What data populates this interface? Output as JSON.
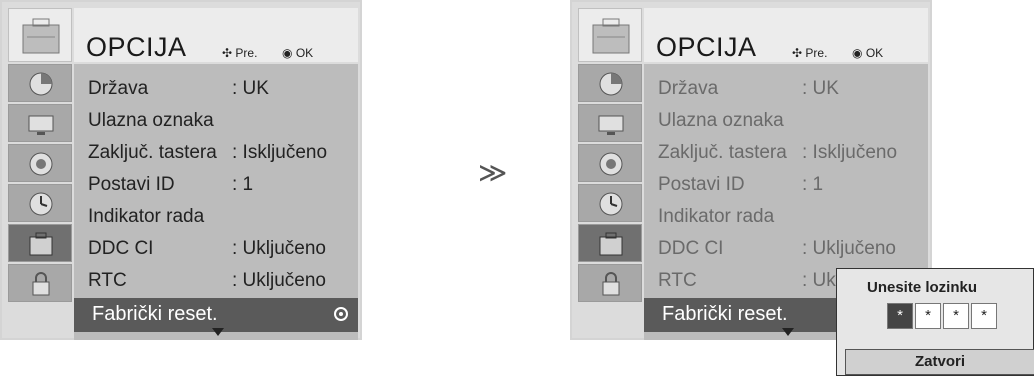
{
  "left_menu": {
    "title": "OPCIJA",
    "hint_move": "Pre.",
    "hint_ok": "OK",
    "rows": [
      {
        "label": "Država",
        "value": ": UK"
      },
      {
        "label": "Ulazna oznaka",
        "value": ""
      },
      {
        "label": "Zaključ. tastera",
        "value": ": Isključeno"
      },
      {
        "label": "Postavi ID",
        "value": ": 1"
      },
      {
        "label": "Indikator rada",
        "value": ""
      },
      {
        "label": "DDC CI",
        "value": ": Uključeno"
      },
      {
        "label": "RTC",
        "value": ": Uključeno"
      }
    ],
    "selected_item": "Fabrički reset."
  },
  "right_menu": {
    "title": "OPCIJA",
    "hint_move": "Pre.",
    "hint_ok": "OK",
    "rows": [
      {
        "label": "Država",
        "value": ": UK"
      },
      {
        "label": "Ulazna oznaka",
        "value": ""
      },
      {
        "label": "Zaključ. tastera",
        "value": ": Isključeno"
      },
      {
        "label": "Postavi ID",
        "value": ": 1"
      },
      {
        "label": "Indikator rada",
        "value": ""
      },
      {
        "label": "DDC CI",
        "value": ": Uključeno"
      },
      {
        "label": "RTC",
        "value": ": Uk"
      }
    ],
    "selected_item": "Fabrički reset."
  },
  "transition_arrow": "≫",
  "password_popup": {
    "title": "Unesite lozinku",
    "digits": [
      "*",
      "*",
      "*",
      "*"
    ],
    "close_label": "Zatvori"
  },
  "sidebar_icons": [
    "picture-icon",
    "screen-icon",
    "audio-icon",
    "time-icon",
    "option-icon",
    "lock-icon"
  ]
}
